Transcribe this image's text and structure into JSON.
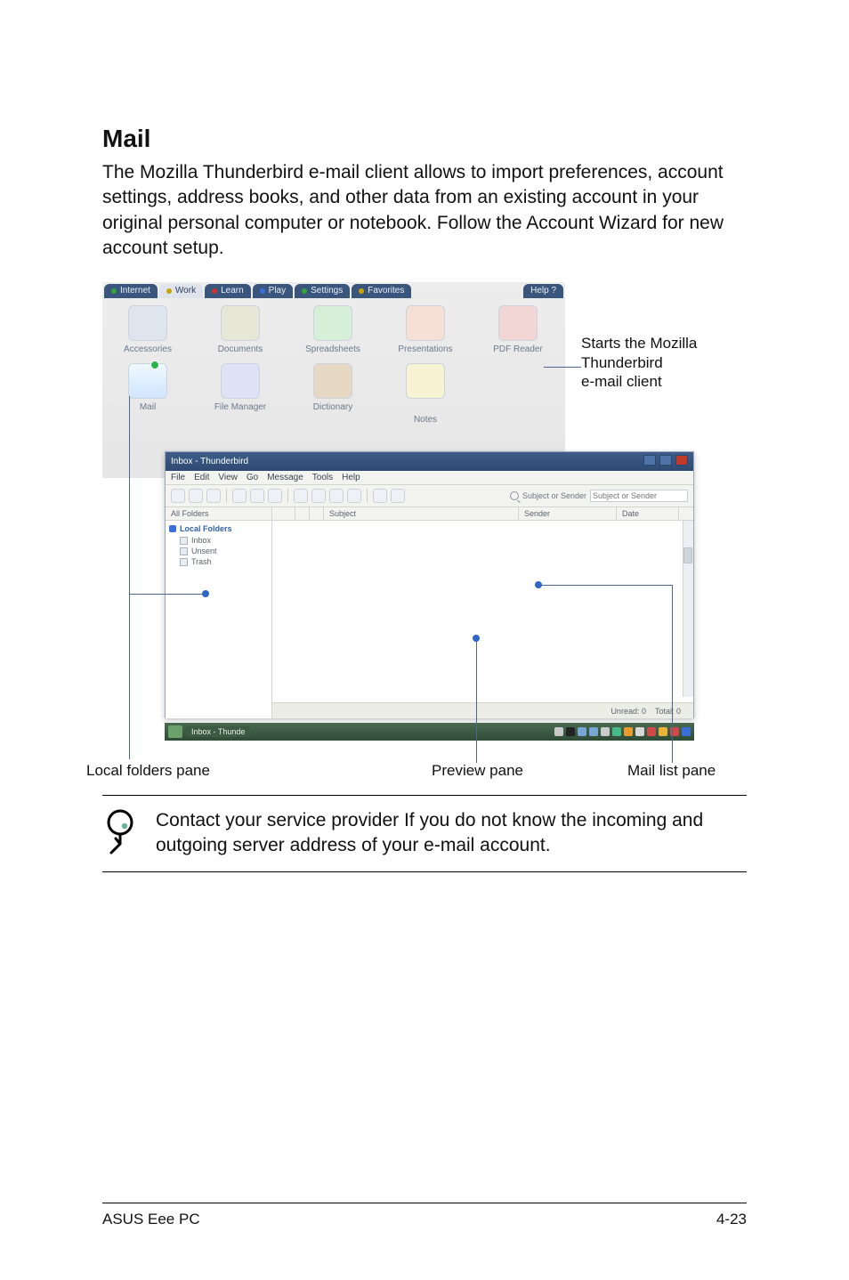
{
  "section": {
    "title": "Mail"
  },
  "paragraph": "The Mozilla Thunderbird e-mail client allows to import preferences, account settings, address books, and other data from an existing account in your original personal computer or notebook. Follow the Account Wizard for new account setup.",
  "top_tabs": [
    {
      "label": "Internet",
      "dot": "g"
    },
    {
      "label": "Work",
      "dot": "y",
      "active": true
    },
    {
      "label": "Learn",
      "dot": "r"
    },
    {
      "label": "Play",
      "dot": "b"
    },
    {
      "label": "Settings",
      "dot": "g"
    },
    {
      "label": "Favorites",
      "dot": "y"
    },
    {
      "label": "Help ?",
      "dot": "b",
      "right": true
    }
  ],
  "desktop_icons": {
    "row1": [
      "Accessories",
      "Documents",
      "Spreadsheets",
      "Presentations",
      "PDF Reader"
    ],
    "row2": [
      "Mail",
      "File Manager",
      "Dictionary",
      "Notes"
    ]
  },
  "annotation_right": "Starts the Mozilla Thunderbird\ne-mail client",
  "thunderbird": {
    "title": "Inbox - Thunderbird",
    "menus": [
      "File",
      "Edit",
      "View",
      "Go",
      "Message",
      "Tools",
      "Help"
    ],
    "search_label": "Subject or Sender",
    "columns": {
      "folders": "All Folders",
      "subject": "Subject",
      "sender": "Sender",
      "date": "Date"
    },
    "folders": {
      "header": "Local Folders",
      "items": [
        "Inbox",
        "Unsent",
        "Trash"
      ]
    },
    "status": {
      "unread": "Unread: 0",
      "total": "Total: 0"
    },
    "taskbar_task": "Inbox - Thunde"
  },
  "callouts": {
    "left": "Local folders pane",
    "mid": "Preview pane",
    "right": "Mail list pane"
  },
  "note": "Contact your service provider If you do not know the incoming and outgoing server address of your e-mail account.",
  "footer": {
    "left": "ASUS Eee PC",
    "right": "4-23"
  }
}
